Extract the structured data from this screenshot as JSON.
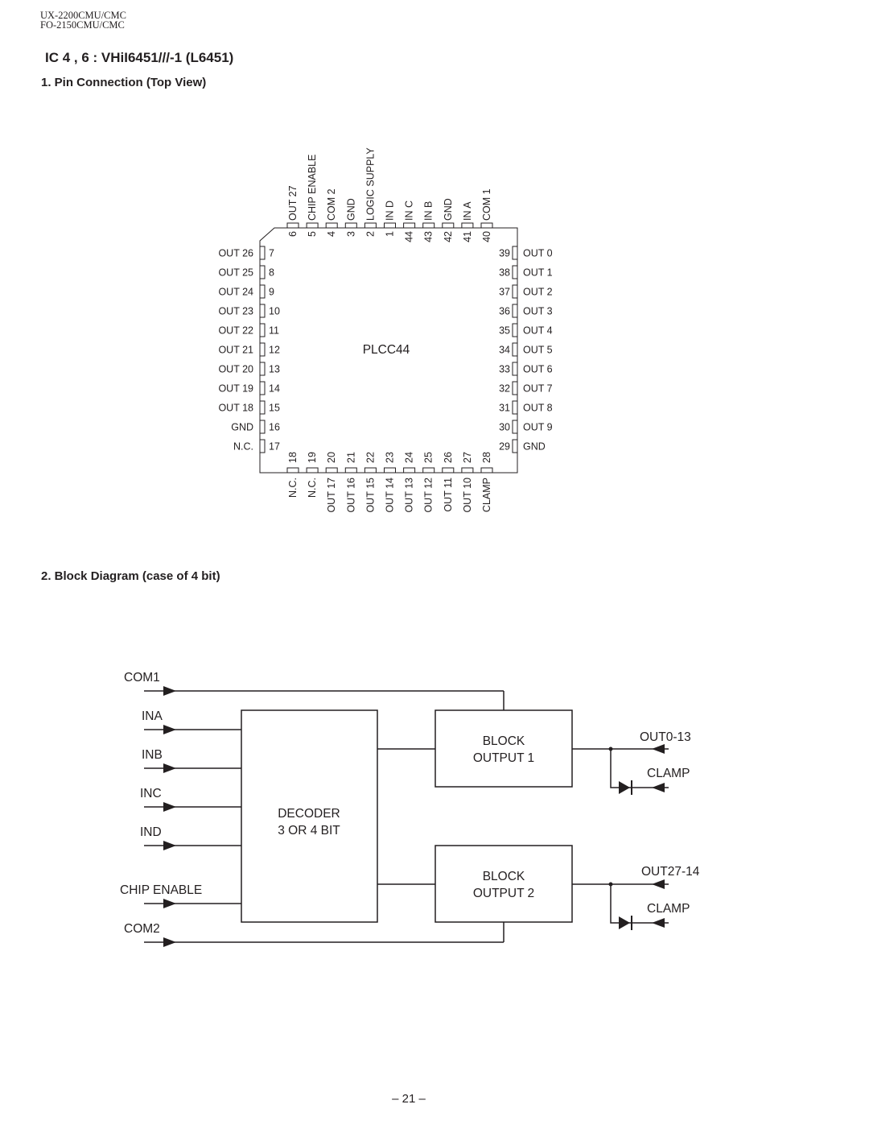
{
  "header": {
    "model_line_1": "UX-2200CMU/CMC",
    "model_line_2": "FO-2150CMU/CMC"
  },
  "title": "IC 4 , 6 : VHiI6451///-1 (L6451)",
  "section1": {
    "heading": "1.  Pin Connection (Top View)",
    "package": "PLCC44",
    "top_pins": [
      {
        "num": "6",
        "name": "OUT 27"
      },
      {
        "num": "5",
        "name": "CHIP ENABLE"
      },
      {
        "num": "4",
        "name": "COM 2"
      },
      {
        "num": "3",
        "name": "GND"
      },
      {
        "num": "2",
        "name": "LOGIC SUPPLY"
      },
      {
        "num": "1",
        "name": "IN D"
      },
      {
        "num": "44",
        "name": "IN C"
      },
      {
        "num": "43",
        "name": "IN B"
      },
      {
        "num": "42",
        "name": "GND"
      },
      {
        "num": "41",
        "name": "IN A"
      },
      {
        "num": "40",
        "name": "COM 1"
      }
    ],
    "left_pins": [
      {
        "num": "7",
        "name": "OUT 26"
      },
      {
        "num": "8",
        "name": "OUT 25"
      },
      {
        "num": "9",
        "name": "OUT 24"
      },
      {
        "num": "10",
        "name": "OUT 23"
      },
      {
        "num": "11",
        "name": "OUT 22"
      },
      {
        "num": "12",
        "name": "OUT 21"
      },
      {
        "num": "13",
        "name": "OUT 20"
      },
      {
        "num": "14",
        "name": "OUT 19"
      },
      {
        "num": "15",
        "name": "OUT 18"
      },
      {
        "num": "16",
        "name": "GND"
      },
      {
        "num": "17",
        "name": "N.C."
      }
    ],
    "right_pins": [
      {
        "num": "39",
        "name": "OUT 0"
      },
      {
        "num": "38",
        "name": "OUT 1"
      },
      {
        "num": "37",
        "name": "OUT 2"
      },
      {
        "num": "36",
        "name": "OUT 3"
      },
      {
        "num": "35",
        "name": "OUT 4"
      },
      {
        "num": "34",
        "name": "OUT 5"
      },
      {
        "num": "33",
        "name": "OUT 6"
      },
      {
        "num": "32",
        "name": "OUT 7"
      },
      {
        "num": "31",
        "name": "OUT 8"
      },
      {
        "num": "30",
        "name": "OUT 9"
      },
      {
        "num": "29",
        "name": "GND"
      }
    ],
    "bottom_pins": [
      {
        "num": "18",
        "name": "N.C."
      },
      {
        "num": "19",
        "name": "N.C."
      },
      {
        "num": "20",
        "name": "OUT 17"
      },
      {
        "num": "21",
        "name": "OUT 16"
      },
      {
        "num": "22",
        "name": "OUT 15"
      },
      {
        "num": "23",
        "name": "OUT 14"
      },
      {
        "num": "24",
        "name": "OUT 13"
      },
      {
        "num": "25",
        "name": "OUT 12"
      },
      {
        "num": "26",
        "name": "OUT 11"
      },
      {
        "num": "27",
        "name": "OUT 10"
      },
      {
        "num": "28",
        "name": "CLAMP"
      }
    ]
  },
  "section2": {
    "heading": "2.  Block Diagram (case of 4 bit)",
    "inputs": {
      "com1": "COM1",
      "ina": "INA",
      "inb": "INB",
      "inc": "INC",
      "ind": "IND",
      "chip_enable": "CHIP ENABLE",
      "com2": "COM2"
    },
    "decoder": {
      "line1": "DECODER",
      "line2": "3 OR 4 BIT"
    },
    "block1": {
      "line1": "BLOCK",
      "line2": "OUTPUT 1"
    },
    "block2": {
      "line1": "BLOCK",
      "line2": "OUTPUT 2"
    },
    "out1_label": "OUT0-13",
    "clamp1_label": "CLAMP",
    "out2_label": "OUT27-14",
    "clamp2_label": "CLAMP"
  },
  "page_number": "– 21 –"
}
